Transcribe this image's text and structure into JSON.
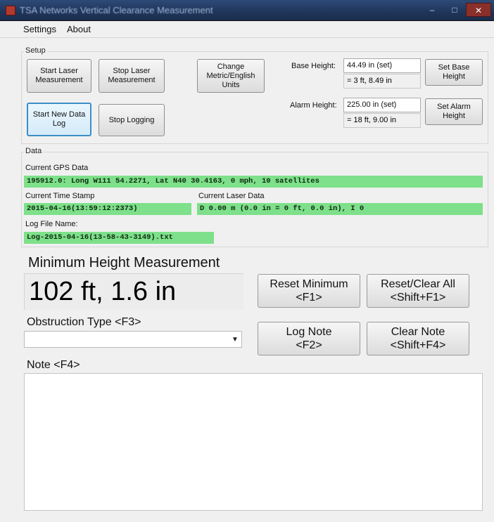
{
  "window": {
    "title": "TSA Networks Vertical Clearance Measurement",
    "min_glyph": "–",
    "max_glyph": "□",
    "close_glyph": "✕"
  },
  "menu": {
    "settings": "Settings",
    "about": "About"
  },
  "setup": {
    "group_title": "Setup",
    "start_laser": "Start Laser\nMeasurement",
    "stop_laser": "Stop Laser\nMeasurement",
    "change_units": "Change\nMetric/English\nUnits",
    "start_log": "Start New Data\nLog",
    "stop_logging": "Stop Logging",
    "base_height_label": "Base Height:",
    "base_height_value": "44.49 in (set)",
    "base_height_converted": "= 3 ft, 8.49 in",
    "set_base": "Set Base\nHeight",
    "alarm_height_label": "Alarm Height:",
    "alarm_height_value": "225.00 in (set)",
    "alarm_height_converted": "= 18 ft, 9.00 in",
    "set_alarm": "Set Alarm\nHeight"
  },
  "data": {
    "group_title": "Data",
    "gps_label": "Current GPS Data",
    "gps_value": "195912.0: Long W111 54.2271, Lat N40 30.4163, 0 mph, 10 satellites",
    "time_label": "Current Time Stamp",
    "time_value": "2015-04-16(13:59:12:2373)",
    "laser_label": "Current Laser Data",
    "laser_value": "D 0.00 m (0.0 in = 0 ft, 0.0 in), I 0",
    "logfile_label": "Log File Name:",
    "logfile_value": "Log-2015-04-16(13-58-43-3149).txt"
  },
  "measurement": {
    "heading": "Minimum Height Measurement",
    "value": "102 ft, 1.6 in",
    "reset_minimum": "Reset Minimum\n<F1>",
    "reset_clear_all": "Reset/Clear All\n<Shift+F1>",
    "obstruction_label": "Obstruction Type <F3>",
    "obstruction_selected": "",
    "log_note": "Log Note\n<F2>",
    "clear_note": "Clear Note\n<Shift+F4>",
    "note_label": "Note <F4>",
    "note_text": ""
  },
  "colors": {
    "green_field": "#7ee08a",
    "focus_border": "#3c8fc6",
    "titlebar": "#1f3559"
  }
}
